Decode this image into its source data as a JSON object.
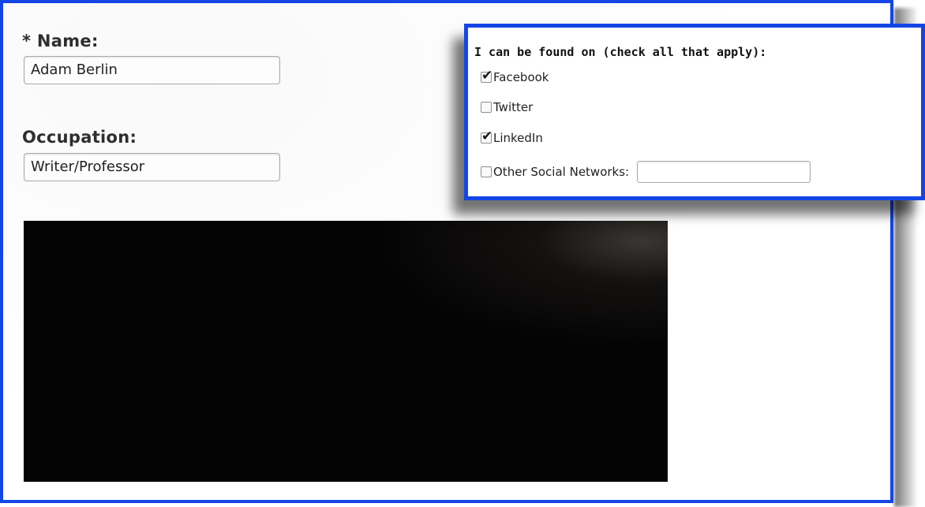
{
  "form": {
    "name_label": "* Name:",
    "name_value": "Adam Berlin",
    "occupation_label": "Occupation:",
    "occupation_value": "Writer/Professor"
  },
  "social": {
    "heading": "I can be found on (check all that apply):",
    "options": [
      {
        "label": "Facebook",
        "checked": true
      },
      {
        "label": "Twitter",
        "checked": false
      },
      {
        "label": "LinkedIn",
        "checked": true
      },
      {
        "label": "Other Social Networks:",
        "checked": false,
        "has_input": true,
        "input_value": ""
      }
    ]
  },
  "colors": {
    "frame_border": "#1446e6",
    "photo": "#050405"
  },
  "icons": {
    "checkbox_checked": "check-mark-icon"
  }
}
